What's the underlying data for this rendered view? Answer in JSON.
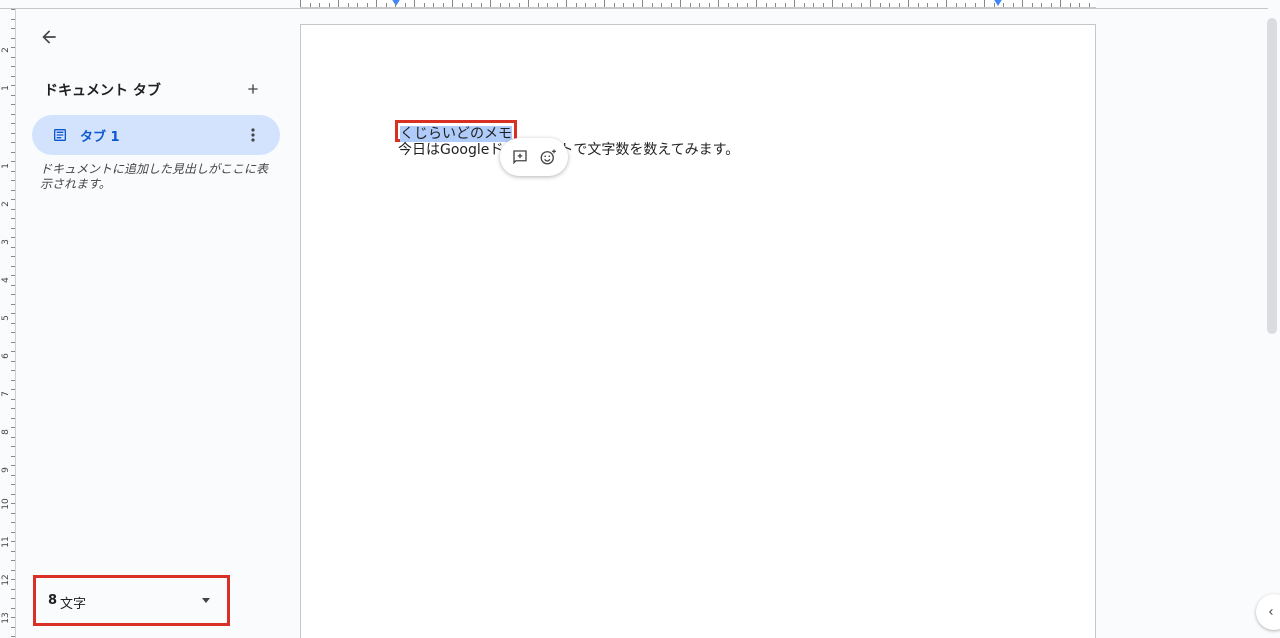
{
  "sidebar": {
    "tabs_header": "ドキュメント タブ",
    "tab_label": "タブ 1",
    "outline_hint": "ドキュメントに追加した見出しがここに表示されます。",
    "word_count": {
      "count": "8",
      "unit": "文字"
    }
  },
  "document": {
    "title": "くじらいどのメモ",
    "body": "今日はGoogleドキュメントで文字数を数えてみます。"
  },
  "vertical_ruler": [
    "2",
    "1",
    "1",
    "2",
    "3",
    "4",
    "5",
    "6",
    "7",
    "8",
    "9",
    "10",
    "11",
    "12",
    "13"
  ],
  "colors": {
    "accent": "#0b57d0",
    "tab_bg": "#d3e3fd",
    "highlight": "#aecbfa",
    "annotation": "#d93025"
  },
  "icons": {
    "back": "arrow-left-icon",
    "add": "plus-icon",
    "doc": "document-icon",
    "more": "more-vert-icon",
    "comment": "add-comment-icon",
    "emoji": "emoji-react-icon",
    "collapse": "chevron-left-icon"
  }
}
